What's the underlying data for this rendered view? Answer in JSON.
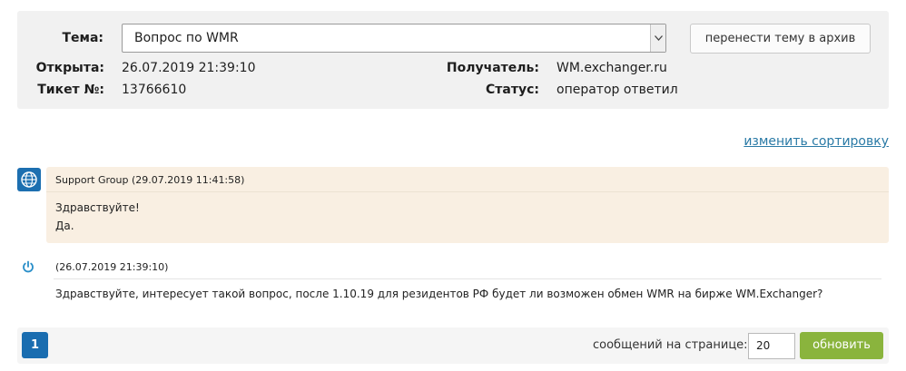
{
  "ticket": {
    "subject_label": "Тема:",
    "subject_value": "Вопрос по WMR",
    "archive_button": "перенести тему в архив",
    "opened_label": "Открыта:",
    "opened_value": "26.07.2019 21:39:10",
    "ticket_label": "Тикет №:",
    "ticket_value": "13766610",
    "recipient_label": "Получатель:",
    "recipient_value": "WM.exchanger.ru",
    "status_label": "Статус:",
    "status_value": "оператор ответил"
  },
  "sort_link": "изменить сортировку",
  "messages": [
    {
      "author_icon": "webmoney-globe-icon",
      "header": "Support Group (29.07.2019 11:41:58)",
      "lines": [
        "Здравствуйте!",
        "Да."
      ]
    },
    {
      "author_icon": "user-power-icon",
      "header": "(26.07.2019 21:39:10)",
      "lines": [
        "Здравствуйте, интересует такой вопрос, после 1.10.19 для резидентов РФ будет ли возможен обмен WMR на бирже WM.Exchanger?"
      ]
    }
  ],
  "pager": {
    "current_page": "1",
    "per_page_label": "сообщений на странице:",
    "per_page_value": "20",
    "refresh_button": "обновить"
  },
  "colors": {
    "accent_blue": "#1a6db0",
    "link": "#2a7aa6",
    "support_bg": "#f9efe2",
    "refresh_green": "#8ab43d"
  }
}
